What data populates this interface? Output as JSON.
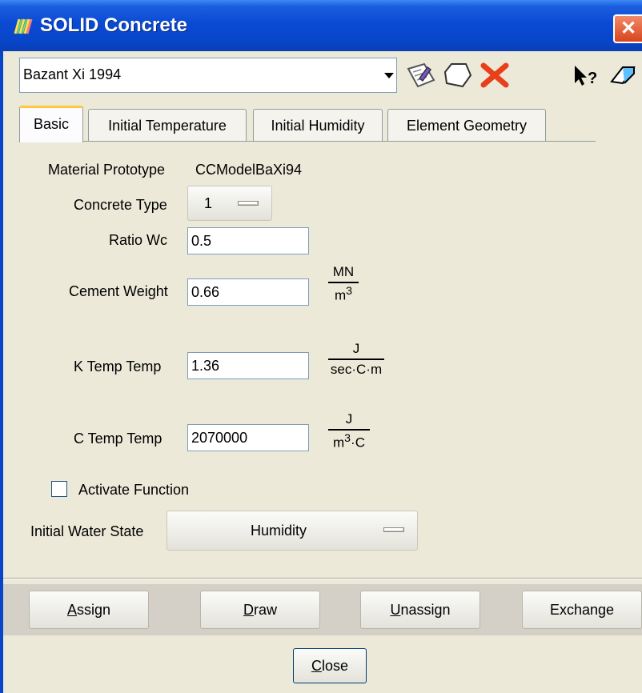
{
  "window": {
    "title": "SOLID Concrete"
  },
  "toolbar": {
    "model_value": "Bazant Xi 1994",
    "icons": [
      "edit-list-icon",
      "blank-tag-icon",
      "delete-x-icon",
      "help-pointer-icon",
      "eraser-icon"
    ]
  },
  "tabs": [
    {
      "label": "Basic",
      "active": true
    },
    {
      "label": "Initial Temperature",
      "active": false
    },
    {
      "label": "Initial Humidity",
      "active": false
    },
    {
      "label": "Element Geometry",
      "active": false
    }
  ],
  "basic": {
    "material_prototype_label": "Material Prototype",
    "material_prototype_value": "CCModelBaXi94",
    "concrete_type_label": "Concrete Type",
    "concrete_type_value": "1",
    "ratio_wc_label": "Ratio Wc",
    "ratio_wc_value": "0.5",
    "cement_weight_label": "Cement Weight",
    "cement_weight_value": "0.66",
    "cement_weight_unit_num": "MN",
    "cement_weight_unit_den": "m",
    "cement_weight_unit_den_sup": "3",
    "k_temp_label": "K Temp Temp",
    "k_temp_value": "1.36",
    "k_temp_unit_num": "J",
    "k_temp_unit_den": "sec·C·m",
    "c_temp_label": "C Temp Temp",
    "c_temp_value": "2070000",
    "c_temp_unit_num": "J",
    "c_temp_unit_den_a": "m",
    "c_temp_unit_den_sup": "3",
    "c_temp_unit_den_b": "·C",
    "activate_function_label": "Activate Function",
    "activate_function_checked": false,
    "initial_water_state_label": "Initial Water State",
    "initial_water_state_value": "Humidity"
  },
  "buttons": {
    "assign_key": "A",
    "assign_rest": "ssign",
    "draw_key": "D",
    "draw_rest": "raw",
    "unassign_key": "U",
    "unassign_rest": "nassign",
    "exchange": "Exchange",
    "close_key": "C",
    "close_rest": "lose"
  },
  "colors": {
    "titlebar": "#0846c9",
    "dialog": "#ece9d8",
    "active_tab_accent": "#ffc83c",
    "close_box": "#d9441b"
  }
}
